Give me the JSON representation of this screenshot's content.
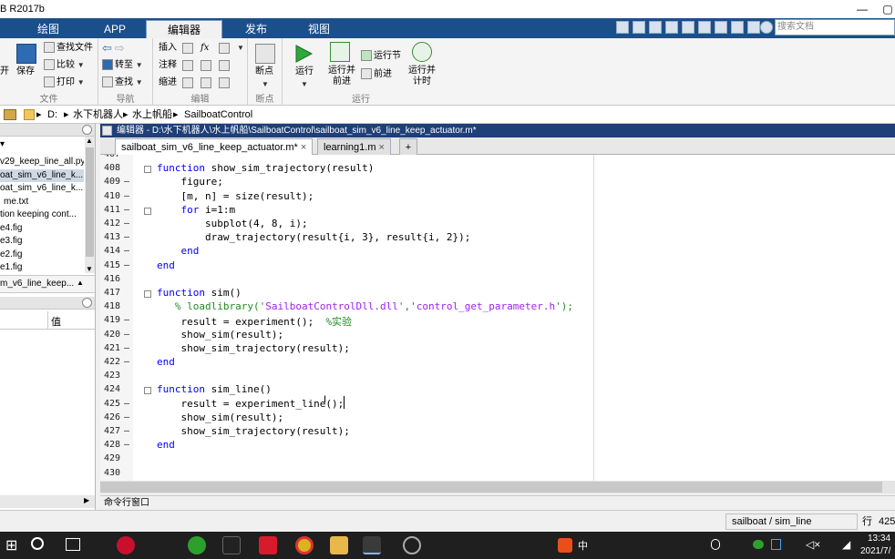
{
  "window": {
    "title": "B R2017b"
  },
  "tabs": [
    "绘图",
    "APP",
    "编辑器",
    "发布",
    "视图"
  ],
  "search": {
    "placeholder": "搜索文档"
  },
  "ribbon": {
    "file": {
      "label": "文件",
      "items": [
        "开",
        "保存",
        "查找文件",
        "比较",
        "打印"
      ]
    },
    "nav": {
      "label": "导航",
      "items": [
        "转至",
        "查找"
      ]
    },
    "edit": {
      "label": "编辑",
      "items": [
        "插入",
        "注释",
        "缩进"
      ],
      "icons": [
        "fx"
      ]
    },
    "bp": {
      "label": "断点",
      "items": [
        "断点"
      ]
    },
    "run": {
      "label": "运行",
      "items": [
        "运行",
        "运行并\n前进",
        "运行节",
        "前进",
        "运行并\n计时"
      ]
    }
  },
  "address": {
    "path": [
      "D:",
      "水下机器人",
      "水上帆船",
      "SailboatControl"
    ]
  },
  "leftpanel": {
    "files": [
      "v29_keep_line_all.py",
      "oat_sim_v6_line_k...",
      "oat_sim_v6_line_k...",
      "me.txt",
      "tion keeping cont...",
      "e4.fig",
      "e3.fig",
      "e2.fig",
      "e1.fig"
    ],
    "selected_index": 1,
    "bottom_file": "m_v6_line_keep...",
    "ws_header": "值"
  },
  "editor": {
    "title": "编辑器 - D:\\水下机器人\\水上帆船\\SailboatControl\\sailboat_sim_v6_line_keep_actuator.m*",
    "tabs": [
      "sailboat_sim_v6_line_keep_actuator.m*",
      "learning1.m"
    ],
    "lines": [
      {
        "n": "407",
        "t": ""
      },
      {
        "n": "408",
        "t": "function show_sim_trajectory(result)"
      },
      {
        "n": "409",
        "t": "    figure;"
      },
      {
        "n": "410",
        "t": "    [m, n] = size(result);"
      },
      {
        "n": "411",
        "t": "    for i=1:m"
      },
      {
        "n": "412",
        "t": "        subplot(4, 8, i);"
      },
      {
        "n": "413",
        "t": "        draw_trajectory(result{i, 3}, result{i, 2});"
      },
      {
        "n": "414",
        "t": "    end"
      },
      {
        "n": "415",
        "t": "end"
      },
      {
        "n": "416",
        "t": ""
      },
      {
        "n": "417",
        "t": "function sim()"
      },
      {
        "n": "418",
        "t": "   % loadlibrary('SailboatControlDll.dll','control_get_parameter.h');"
      },
      {
        "n": "419",
        "t": "    result = experiment();  %实验"
      },
      {
        "n": "420",
        "t": "    show_sim(result);"
      },
      {
        "n": "421",
        "t": "    show_sim_trajectory(result);"
      },
      {
        "n": "422",
        "t": "end"
      },
      {
        "n": "423",
        "t": ""
      },
      {
        "n": "424",
        "t": "function sim_line()"
      },
      {
        "n": "425",
        "t": "    result = experiment_line();"
      },
      {
        "n": "426",
        "t": "    show_sim(result);"
      },
      {
        "n": "427",
        "t": "    show_sim_trajectory(result);"
      },
      {
        "n": "428",
        "t": "end"
      },
      {
        "n": "429",
        "t": ""
      },
      {
        "n": "430",
        "t": ""
      }
    ]
  },
  "cmdwindow": {
    "label": "命令行窗口"
  },
  "status": {
    "func": "sailboat / sim_line",
    "pos_label": "行",
    "pos": "425"
  },
  "clock": {
    "time": "13:34",
    "date": "2021/7/"
  },
  "tray": {
    "ime": "中"
  }
}
